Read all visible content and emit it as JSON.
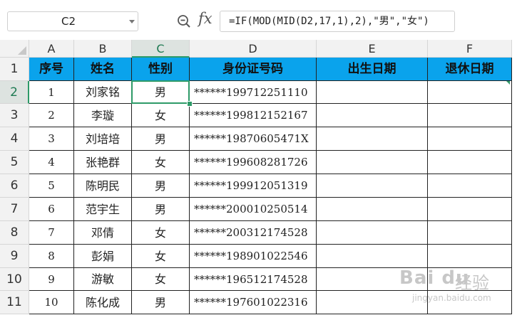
{
  "formula_bar": {
    "name_box": "C2",
    "fx_icon": "fx",
    "formula": "=IF(MOD(MID(D2,17,1),2),\"男\",\"女\")"
  },
  "columns": [
    "A",
    "B",
    "C",
    "D",
    "E",
    "F"
  ],
  "selected_column": "C",
  "selected_row": 2,
  "row_numbers": [
    "1",
    "2",
    "3",
    "4",
    "5",
    "6",
    "7",
    "8",
    "9",
    "10",
    "11"
  ],
  "table": {
    "headers": [
      "序号",
      "姓名",
      "性别",
      "身份证号码",
      "出生日期",
      "退休日期"
    ],
    "rows": [
      [
        "1",
        "刘家铭",
        "男",
        "******199712251110",
        "",
        ""
      ],
      [
        "2",
        "李璇",
        "女",
        "******199812152167",
        "",
        ""
      ],
      [
        "3",
        "刘培培",
        "男",
        "******19870605471X",
        "",
        ""
      ],
      [
        "4",
        "张艳群",
        "女",
        "******199608281726",
        "",
        ""
      ],
      [
        "5",
        "陈明民",
        "男",
        "******199912051319",
        "",
        ""
      ],
      [
        "6",
        "范宇生",
        "男",
        "******200010250514",
        "",
        ""
      ],
      [
        "7",
        "邓倩",
        "女",
        "******200312174528",
        "",
        ""
      ],
      [
        "8",
        "彭娟",
        "女",
        "******198901022546",
        "",
        ""
      ],
      [
        "9",
        "游敏",
        "女",
        "******196512174528",
        "",
        ""
      ],
      [
        "10",
        "陈化成",
        "男",
        "******197601022316",
        "",
        ""
      ]
    ]
  },
  "colors": {
    "header_fill": "#0aa3ec",
    "selection": "#2e9a68"
  },
  "watermark": {
    "logo": "Bai du",
    "cn": "经验",
    "url": "jingyan.baidu.com"
  }
}
